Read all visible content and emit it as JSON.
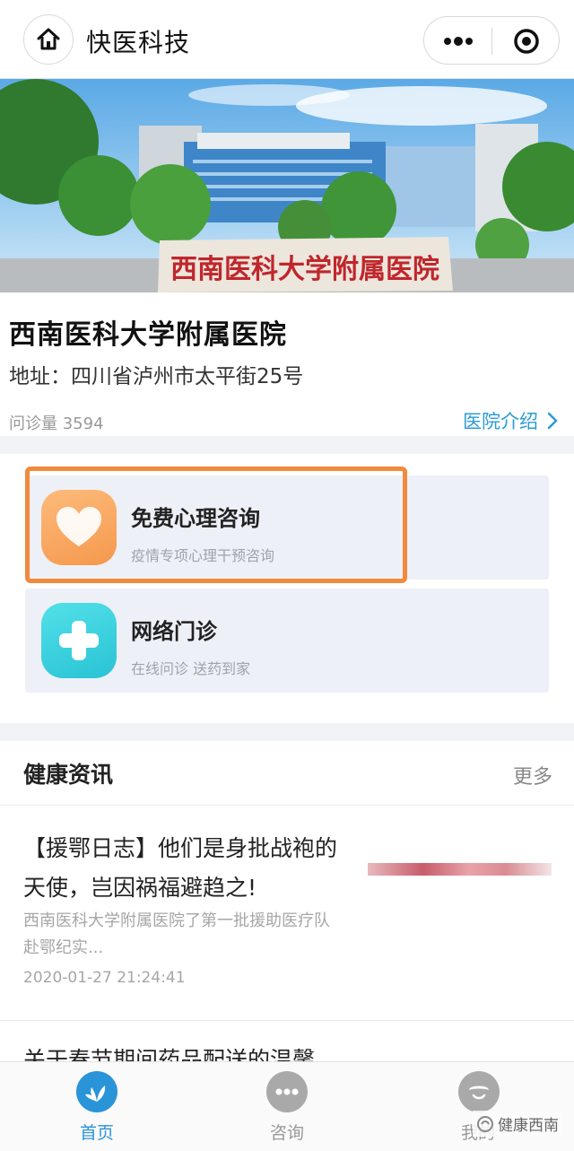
{
  "navbar": {
    "title": "快医科技",
    "home_icon": "home-icon",
    "more_icon": "more-dots-icon",
    "close_icon": "target-circle-icon"
  },
  "hospital": {
    "name": "西南医科大学附属医院",
    "address": "地址：四川省泸州市太平街25号",
    "visits": "问诊量 3594",
    "intro_link": "医院介绍"
  },
  "services": [
    {
      "title": "免费心理咨询",
      "subtitle": "疫情专项心理干预咨询",
      "icon": "heart-icon",
      "color": "#f5984d"
    },
    {
      "title": "网络门诊",
      "subtitle": "在线问诊 送药到家",
      "icon": "plus-cross-icon",
      "color": "#29c3d6"
    }
  ],
  "news": {
    "section_title": "健康资讯",
    "more_label": "更多",
    "items": [
      {
        "title": "【援鄂日志】他们是身批战袍的天使，岂因祸福避趋之!",
        "summary": "西南医科大学附属医院了第一批援助医疗队赴鄂纪实...",
        "time": "2020-01-27 21:24:41"
      },
      {
        "title": "关于春节期间药品配送的温馨"
      }
    ]
  },
  "tabbar": {
    "tabs": [
      {
        "label": "首页",
        "icon": "home-leaf-icon",
        "active": true
      },
      {
        "label": "咨询",
        "icon": "chat-bubble-icon",
        "active": false
      },
      {
        "label": "我的",
        "icon": "user-face-icon",
        "active": false
      }
    ]
  },
  "watermark": "健康西南",
  "colors": {
    "accent": "#2a94d8",
    "highlight_border": "#f18a3c"
  }
}
